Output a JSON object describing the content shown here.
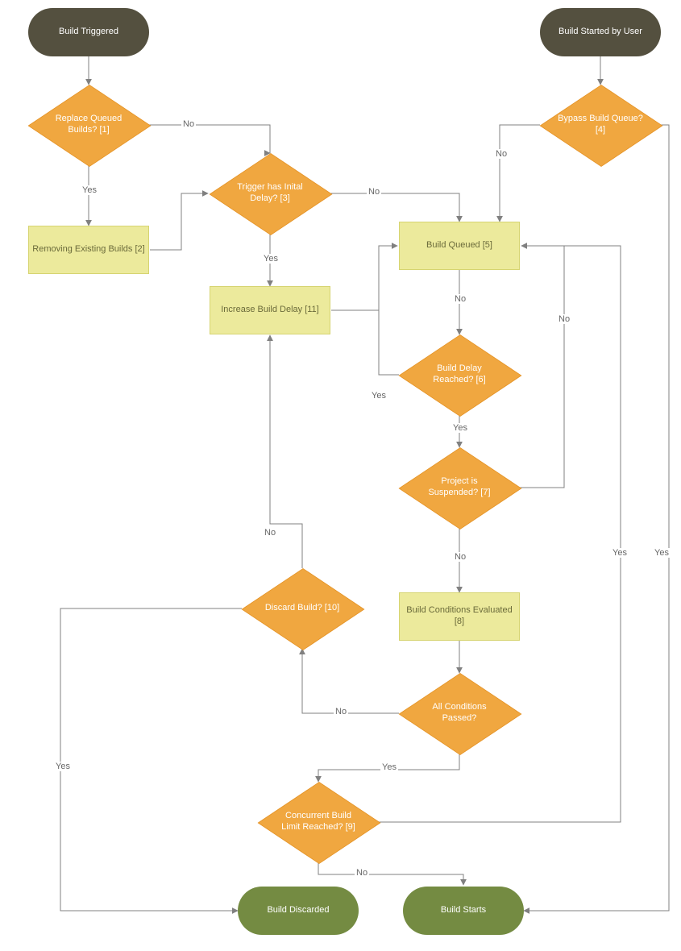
{
  "nodes": {
    "start_triggered": "Build Triggered",
    "start_user": "Build Started by User",
    "end_discarded": "Build Discarded",
    "end_starts": "Build Starts",
    "d_replace": "Replace Queued Builds? [1]",
    "p_remove_existing": "Removing Existing Builds [2]",
    "d_initial_delay": "Trigger has Inital Delay? [3]",
    "d_bypass": "Bypass Build Queue? [4]",
    "p_queued": "Build Queued [5]",
    "d_delay_reached": "Build Delay Reached? [6]",
    "d_suspended": "Project is Suspended? [7]",
    "p_conditions_eval": "Build Conditions Evaluated [8]",
    "d_all_passed": "All Conditions Passed?",
    "d_concurrent": "Concurrent Build Limit Reached? [9]",
    "d_discard": "Discard Build? [10]",
    "p_increase_delay": "Increase Build Delay [11]"
  },
  "labels": {
    "yes": "Yes",
    "no": "No"
  },
  "colors": {
    "terminator_dark": "#54503f",
    "terminator_green": "#748b42",
    "decision_fill": "#f0a740",
    "process_fill": "#ecea9c",
    "edge": "#808080"
  }
}
